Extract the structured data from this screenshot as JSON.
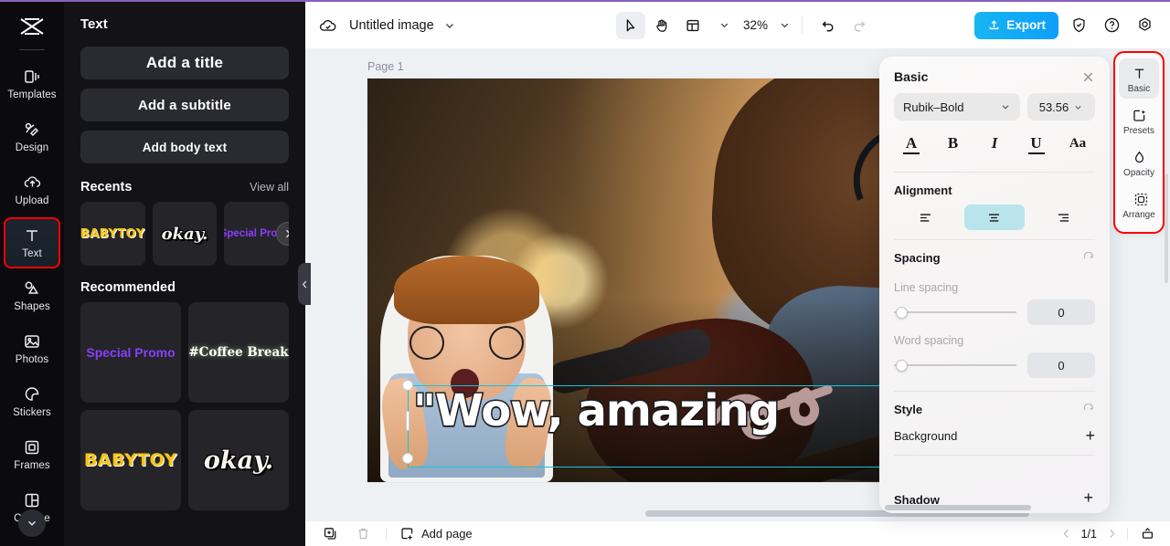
{
  "colors": {
    "accent_cyan": "#16c4dc",
    "export_blue": "#0f9ffb",
    "highlight_red": "#ff0000",
    "panel_dark": "#121217",
    "rail_dark": "#0b0b0f",
    "align_selected": "#b9e4ec",
    "promo_purple": "#8b3ffd",
    "babytoy_yellow": "#f5c518"
  },
  "left_rail": {
    "logo": "capcut-logo",
    "items": [
      {
        "label": "Templates",
        "icon": "templates-icon"
      },
      {
        "label": "Design",
        "icon": "design-icon"
      },
      {
        "label": "Upload",
        "icon": "upload-cloud-icon"
      },
      {
        "label": "Text",
        "icon": "text-t-icon",
        "active": true
      },
      {
        "label": "Shapes",
        "icon": "shapes-icon"
      },
      {
        "label": "Photos",
        "icon": "photos-icon"
      },
      {
        "label": "Stickers",
        "icon": "stickers-icon"
      },
      {
        "label": "Frames",
        "icon": "frames-icon"
      },
      {
        "label": "Collage",
        "icon": "collage-icon"
      }
    ],
    "more_label": "chevron-down"
  },
  "text_panel": {
    "title": "Text",
    "buttons": [
      {
        "label": "Add a title"
      },
      {
        "label": "Add a subtitle"
      },
      {
        "label": "Add body text"
      }
    ],
    "recents": {
      "heading": "Recents",
      "view_all": "View all",
      "items": [
        {
          "label": "BABYTOY",
          "style": "babytoy"
        },
        {
          "label": "okay.",
          "style": "okay"
        },
        {
          "label": "Special Promo",
          "style": "promo"
        }
      ]
    },
    "recommended": {
      "heading": "Recommended",
      "items": [
        {
          "label": "Special Promo",
          "style": "promo"
        },
        {
          "label": "#Coffee Break",
          "style": "coffee"
        },
        {
          "label": "BABYTOY",
          "style": "babytoy"
        },
        {
          "label": "okay.",
          "style": "okay"
        }
      ]
    },
    "collapse_handle": "chevron-left"
  },
  "topbar": {
    "cloud_icon": "cloud-saved-icon",
    "doc_title": "Untitled image",
    "title_chevron": "chevron-down-icon",
    "tools": [
      {
        "name": "select-tool",
        "icon": "cursor-arrow-icon",
        "selected": true
      },
      {
        "name": "hand-tool",
        "icon": "hand-icon",
        "selected": false
      },
      {
        "name": "layout-tool",
        "icon": "layout-icon",
        "selected": false
      }
    ],
    "zoom_level": "32%",
    "zoom_chevron": "chevron-down-icon",
    "undo": "undo-icon",
    "redo": "redo-icon",
    "export_label": "Export",
    "export_icon": "upload-arrow-icon",
    "shield_icon": "shield-check-icon",
    "help_icon": "question-circle-icon",
    "settings_icon": "settings-gear-icon"
  },
  "canvas": {
    "page_label": "Page 1",
    "text_element": "\"Wow, amazing",
    "float_toolbar": [
      {
        "name": "duplicate-button",
        "icon": "duplicate-icon"
      },
      {
        "name": "more-options-button",
        "icon": "ellipsis-icon"
      }
    ],
    "rotate_icon": "rotate-icon"
  },
  "properties": {
    "title": "Basic",
    "close_icon": "close-icon",
    "font_family": "Rubik–Bold",
    "font_size": "53.56",
    "format_buttons": [
      {
        "name": "text-color-button",
        "glyph": "A"
      },
      {
        "name": "bold-button",
        "glyph": "B"
      },
      {
        "name": "italic-button",
        "glyph": "I"
      },
      {
        "name": "underline-button",
        "glyph": "U"
      },
      {
        "name": "case-button",
        "glyph": "Aa"
      }
    ],
    "alignment": {
      "label": "Alignment",
      "options": [
        {
          "name": "align-left",
          "selected": false
        },
        {
          "name": "align-center",
          "selected": true
        },
        {
          "name": "align-right",
          "selected": false
        }
      ]
    },
    "spacing": {
      "label": "Spacing",
      "reset_icon": "reset-icon",
      "line_spacing": {
        "label": "Line spacing",
        "value": "0"
      },
      "word_spacing": {
        "label": "Word spacing",
        "value": "0"
      }
    },
    "style": {
      "label": "Style",
      "reset_icon": "reset-icon",
      "background": {
        "label": "Background",
        "action": "+"
      },
      "shadow": {
        "label": "Shadow",
        "action": "+"
      }
    }
  },
  "right_rail": {
    "items": [
      {
        "label": "Basic",
        "icon": "text-t-icon",
        "selected": true
      },
      {
        "label": "Presets",
        "icon": "presets-icon",
        "selected": false
      },
      {
        "label": "Opacity",
        "icon": "opacity-drop-icon",
        "selected": false
      },
      {
        "label": "Arrange",
        "icon": "arrange-icon",
        "selected": false
      }
    ]
  },
  "bottombar": {
    "duplicate_page_icon": "duplicate-page-icon",
    "delete_page_icon": "trash-icon",
    "add_page_label": "Add page",
    "add_page_icon": "add-page-icon",
    "prev_icon": "chevron-left-icon",
    "page_indicator": "1/1",
    "next_icon": "chevron-right-icon",
    "present_icon": "present-icon"
  }
}
